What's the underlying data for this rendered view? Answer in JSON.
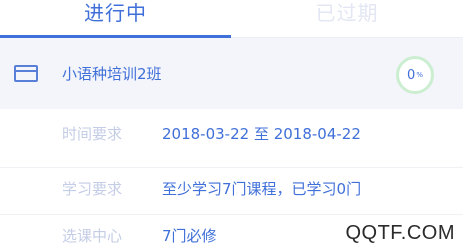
{
  "tabs": [
    {
      "label": "进行中",
      "active": true
    },
    {
      "label": "已过期",
      "active": false
    }
  ],
  "class": {
    "name": "小语种培训2班",
    "icon": "card-icon",
    "progress_value": "0",
    "progress_unit": "%",
    "progress_fraction": 0
  },
  "details": [
    {
      "label": "时间要求",
      "value": "2018-03-22 至 2018-04-22"
    },
    {
      "label": "学习要求",
      "value": "至少学习7门课程，已学习0门"
    },
    {
      "label": "选课中心",
      "value": "7门必修"
    }
  ],
  "watermark": "QQTF.COM",
  "colors": {
    "accent": "#3f6fd8",
    "label": "#c4cde6",
    "inactive_tab": "#e3e7f3",
    "row_background": "#f4f5fa",
    "progress_ring": "#cbeed1"
  }
}
